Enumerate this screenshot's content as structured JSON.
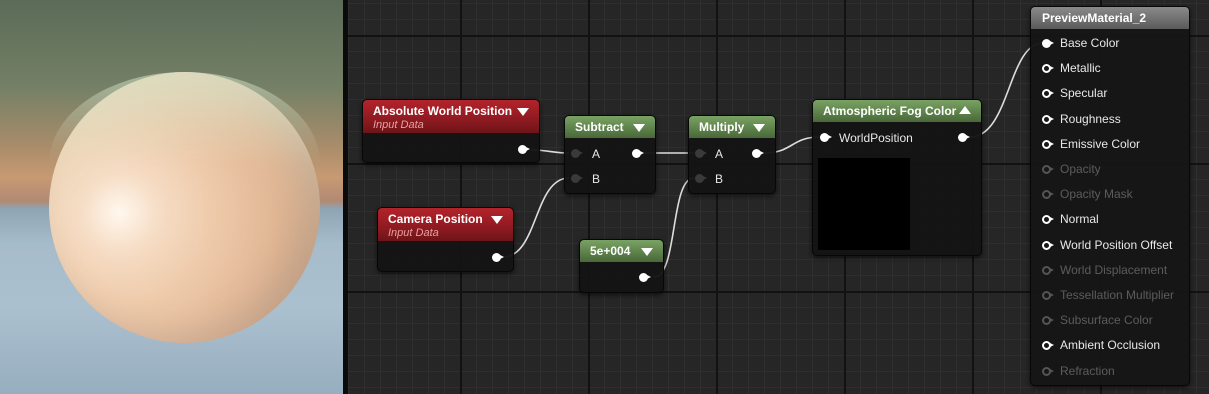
{
  "graph": {
    "nodes": {
      "absolute_world_position": {
        "title": "Absolute World Position",
        "subtitle": "Input Data"
      },
      "camera_position": {
        "title": "Camera Position",
        "subtitle": "Input Data"
      },
      "subtract": {
        "title": "Subtract",
        "inputs": [
          "A",
          "B"
        ]
      },
      "multiply": {
        "title": "Multiply",
        "inputs": [
          "A",
          "B"
        ]
      },
      "constant": {
        "title": "5e+004"
      },
      "atmospheric_fog": {
        "title": "Atmospheric Fog Color",
        "input": "WorldPosition"
      }
    },
    "result": {
      "title": "PreviewMaterial_2",
      "pins": [
        {
          "label": "Base Color",
          "state": "connected"
        },
        {
          "label": "Metallic",
          "state": "enabled"
        },
        {
          "label": "Specular",
          "state": "enabled"
        },
        {
          "label": "Roughness",
          "state": "enabled"
        },
        {
          "label": "Emissive Color",
          "state": "enabled"
        },
        {
          "label": "Opacity",
          "state": "disabled"
        },
        {
          "label": "Opacity Mask",
          "state": "disabled"
        },
        {
          "label": "Normal",
          "state": "enabled"
        },
        {
          "label": "World Position Offset",
          "state": "enabled"
        },
        {
          "label": "World Displacement",
          "state": "disabled"
        },
        {
          "label": "Tessellation Multiplier",
          "state": "disabled"
        },
        {
          "label": "Subsurface Color",
          "state": "disabled"
        },
        {
          "label": "Ambient Occlusion",
          "state": "enabled"
        },
        {
          "label": "Refraction",
          "state": "disabled"
        }
      ]
    }
  },
  "colors": {
    "input_header": "#a31f27",
    "math_header": "#5f8a4b",
    "result_header": "#7a7a7a",
    "canvas": "#262626"
  }
}
